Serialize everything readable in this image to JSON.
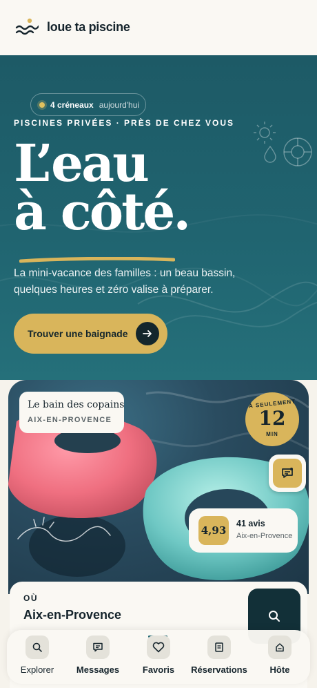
{
  "brand": {
    "name": "loue ta piscine"
  },
  "hero": {
    "slots_count": "4 créneaux",
    "slots_when": "aujourd'hui",
    "kicker": "PISCINES PRIVÉES · PRÈS DE CHEZ VOUS",
    "headline_line1": "L’eau",
    "headline_line2": "à côté.",
    "subtitle": "La mini-vacance des familles : un beau bassin, quelques heures et zéro valise à préparer.",
    "cta_label": "Trouver une baignade"
  },
  "listing": {
    "name": "Le bain des copains",
    "city_caps": "AIX-EN-PROVENCE",
    "badge_top": "À SEULEMENT",
    "badge_minutes": "12",
    "badge_unit": "MIN",
    "rating": "4,93",
    "reviews": "41 avis",
    "city": "Aix-en-Provence"
  },
  "search": {
    "label": "OÙ",
    "value": "Aix-en-Provence"
  },
  "tabs": [
    {
      "label": "Explorer",
      "icon": "search-icon"
    },
    {
      "label": "Messages",
      "icon": "message-icon"
    },
    {
      "label": "Favoris",
      "icon": "heart-icon"
    },
    {
      "label": "Réservations",
      "icon": "document-icon"
    },
    {
      "label": "Hôte",
      "icon": "house-icon"
    }
  ],
  "colors": {
    "teal": "#206470",
    "gold": "#d9b55b",
    "ink": "#15242c",
    "cream": "#faf8f3"
  }
}
